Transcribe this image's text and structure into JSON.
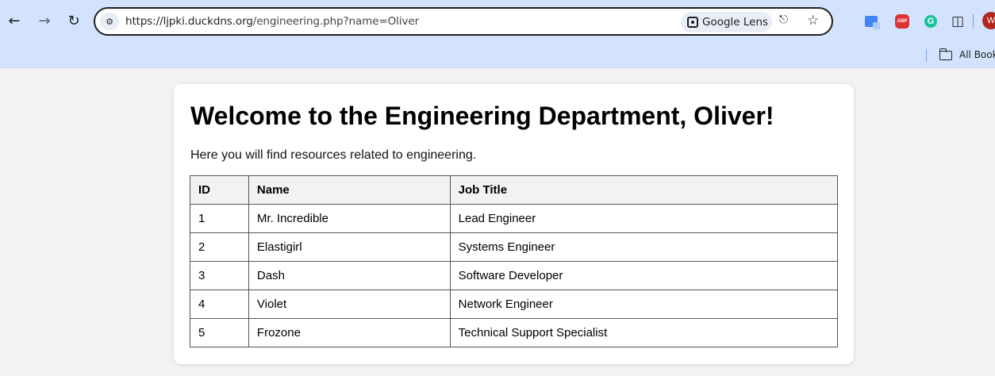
{
  "browser": {
    "url_host": "https://ljpki.duckdns.org",
    "url_path": "/engineering.php?name=Oliver",
    "lens_label": "Google Lens",
    "bookmarks_label": "All Bookmarks",
    "avatar_initial": "W",
    "abp_label": "ABP",
    "grammarly_label": "G",
    "icons": [
      "back-arrow-icon",
      "forward-arrow-icon",
      "reload-icon",
      "site-info-icon",
      "google-lens-icon",
      "key-icon",
      "star-icon",
      "google-translate-icon",
      "adblock-plus-icon",
      "grammarly-icon",
      "extensions-puzzle-icon",
      "folder-icon"
    ]
  },
  "page": {
    "heading": "Welcome to the Engineering Department, Oliver!",
    "intro": "Here you will find resources related to engineering.",
    "table": {
      "headers": [
        "ID",
        "Name",
        "Job Title"
      ],
      "rows": [
        [
          "1",
          "Mr. Incredible",
          "Lead Engineer"
        ],
        [
          "2",
          "Elastigirl",
          "Systems Engineer"
        ],
        [
          "3",
          "Dash",
          "Software Developer"
        ],
        [
          "4",
          "Violet",
          "Network Engineer"
        ],
        [
          "5",
          "Frozone",
          "Technical Support Specialist"
        ]
      ]
    }
  }
}
